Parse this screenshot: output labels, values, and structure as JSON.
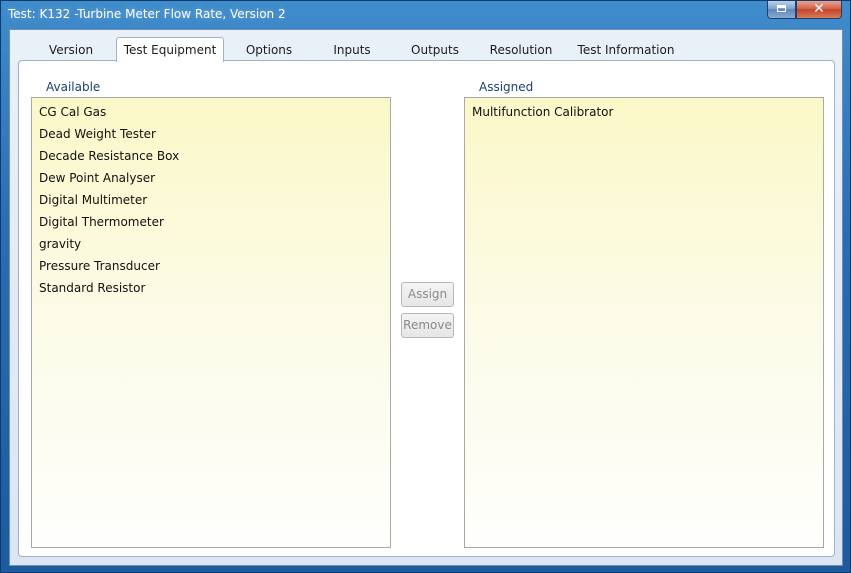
{
  "window": {
    "title": "Test: K132 -Turbine Meter Flow Rate, Version 2",
    "close_glyph": "✕"
  },
  "tabs": [
    {
      "label": "Version"
    },
    {
      "label": "Test Equipment",
      "active": true
    },
    {
      "label": "Options"
    },
    {
      "label": "Inputs"
    },
    {
      "label": "Outputs"
    },
    {
      "label": "Resolution"
    },
    {
      "label": "Test Information"
    }
  ],
  "equipment": {
    "available_label": "Available",
    "assigned_label": "Assigned",
    "available": [
      "CG Cal Gas",
      "Dead Weight Tester",
      "Decade Resistance Box",
      "Dew Point Analyser",
      "Digital Multimeter",
      "Digital Thermometer",
      "gravity",
      "Pressure Transducer",
      "Standard Resistor"
    ],
    "assigned": [
      "Multifunction Calibrator"
    ],
    "assign_label": "Assign",
    "remove_label": "Remove"
  },
  "colors": {
    "title_bar": "#2a6db4",
    "list_background": "#fbf8c8",
    "label_text": "#1e3f6e",
    "disabled_text": "#8a8a8a"
  }
}
